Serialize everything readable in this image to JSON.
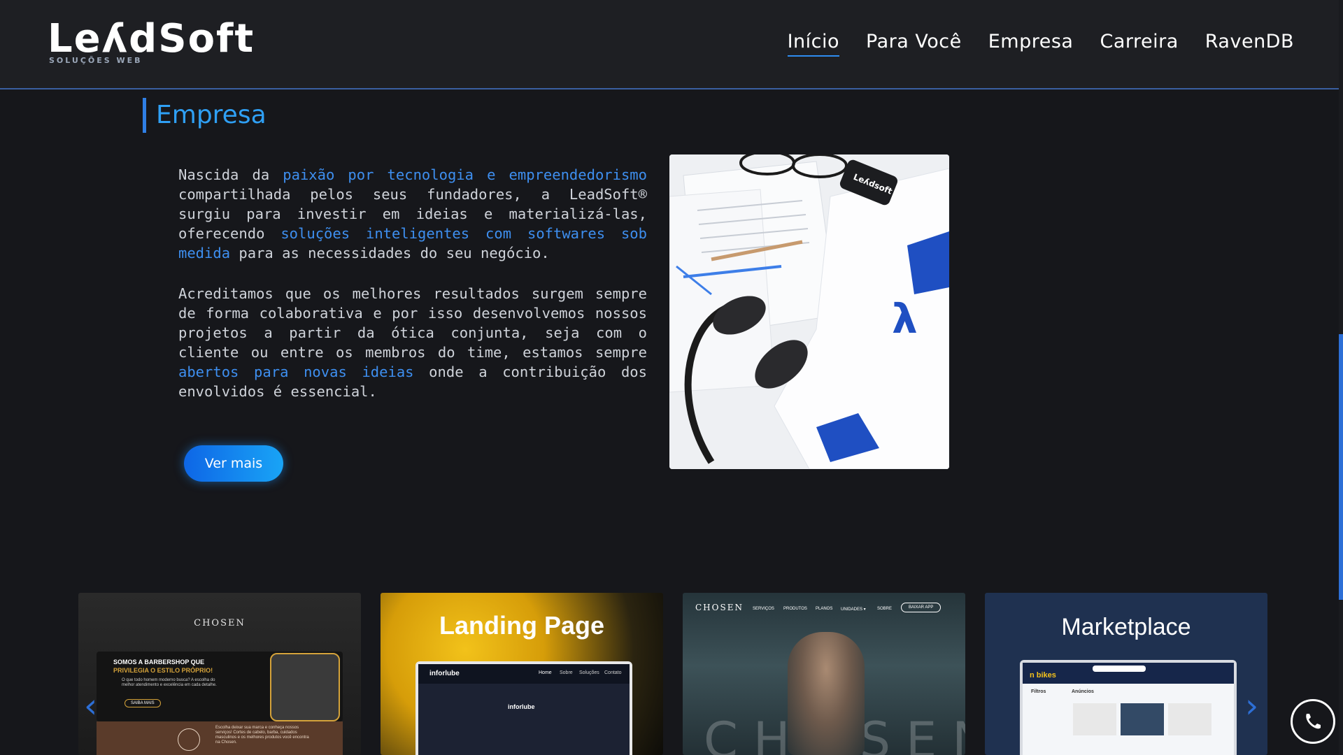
{
  "header": {
    "logo_text": "LeʎdSoft",
    "logo_sub": "SOLUÇÕES WEB",
    "nav": [
      {
        "label": "Início",
        "active": true
      },
      {
        "label": "Para Você",
        "active": false
      },
      {
        "label": "Empresa",
        "active": false
      },
      {
        "label": "Carreira",
        "active": false
      },
      {
        "label": "RavenDB",
        "active": false
      }
    ]
  },
  "section": {
    "title": "Empresa",
    "p1": {
      "a": "Nascida da ",
      "b": "paixão por tecnologia e empreendedorismo",
      "c": " compartilhada pelos seus fundadores, a LeadSoft® surgiu para investir em ideias e materializá-las, oferecendo ",
      "d": "soluções inteligentes com softwares sob medida",
      "e": " para as necessidades do seu negócio."
    },
    "p2": {
      "a": "Acreditamos que os melhores resultados surgem sempre de forma colaborativa e por isso desenvolvemos nossos projetos a partir da ótica conjunta, seja com o cliente ou entre os membros do time, estamos sempre ",
      "b": "abertos para novas ideias",
      "c": " onde a contribuição dos envolvidos é essencial."
    },
    "button": "Ver mais",
    "photo_logo_text": "Leʎdsoft"
  },
  "carousel": {
    "cards": [
      {
        "brand": "CHOSEN",
        "headline": "SOMOS A BARBERSHOP QUE",
        "tagline": "PRIVILEGIA O ESTILO PRÓPRIO!",
        "text": "O que todo homem moderno busca? A escolha do melhor atendimento e excelência em cada detalhe.",
        "button": "SAIBA MAIS",
        "footer_text": "Escolha deixar sua marca e conheça nossos serviços! Cortes de cabelo, barba, cuidados masculinos e os melhores produtos você encontra na Chosen."
      },
      {
        "title": "Landing Page",
        "brand": "inforlube",
        "nav": [
          "Home",
          "Sobre",
          "Soluções",
          "Contato"
        ]
      },
      {
        "brand": "CHOSEN",
        "nav": [
          "SERVIÇOS",
          "PRODUTOS",
          "PLANOS",
          "UNIDADES ▾",
          "SOBRE"
        ],
        "button": "BAIXAR APP",
        "watermark": "CHOSEN"
      },
      {
        "title": "Marketplace",
        "brand": "n bikes",
        "sidebar_title": "Filtros",
        "list_title": "Anúncios"
      }
    ],
    "prev_icon": "‹",
    "next_icon": "›"
  },
  "colors": {
    "accent": "#2f7fe6",
    "highlight": "#3e8ff0",
    "bg": "#16171b"
  }
}
